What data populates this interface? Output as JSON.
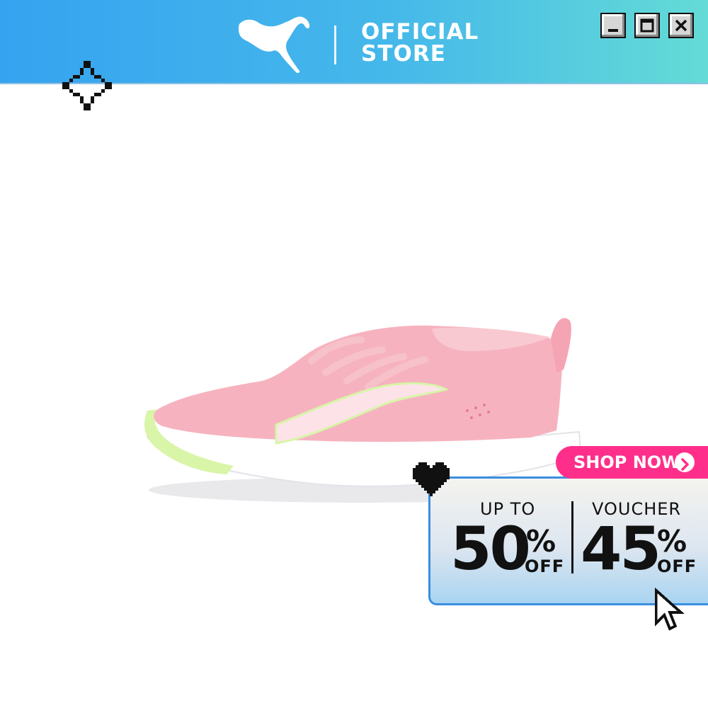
{
  "header": {
    "brand_icon": "puma-cat-logo",
    "store_line1": "OFFICIAL",
    "store_line2": "STORE",
    "window_controls": [
      "minimize-icon",
      "maximize-icon",
      "close-icon"
    ],
    "gradient": [
      "#36a3f0",
      "#64dbd6"
    ]
  },
  "product": {
    "icon": "pink-running-shoe-image",
    "colors": {
      "upper": "#f7b6c0",
      "sole": "#ffffff",
      "accent": "#d8f5a8"
    }
  },
  "promo": {
    "shop_button_label": "SHOP NOW",
    "discount": {
      "prefix": "UP TO",
      "number": "50",
      "percent": "%",
      "suffix": "OFF"
    },
    "voucher": {
      "prefix": "VOUCHER",
      "number": "45",
      "percent": "%",
      "suffix": "OFF"
    },
    "colors": {
      "shop_button": "#ff2e8a",
      "card_border": "#3a8ee0"
    }
  },
  "decor": [
    "sparkle-icon",
    "heart-icon",
    "cursor-icon"
  ]
}
